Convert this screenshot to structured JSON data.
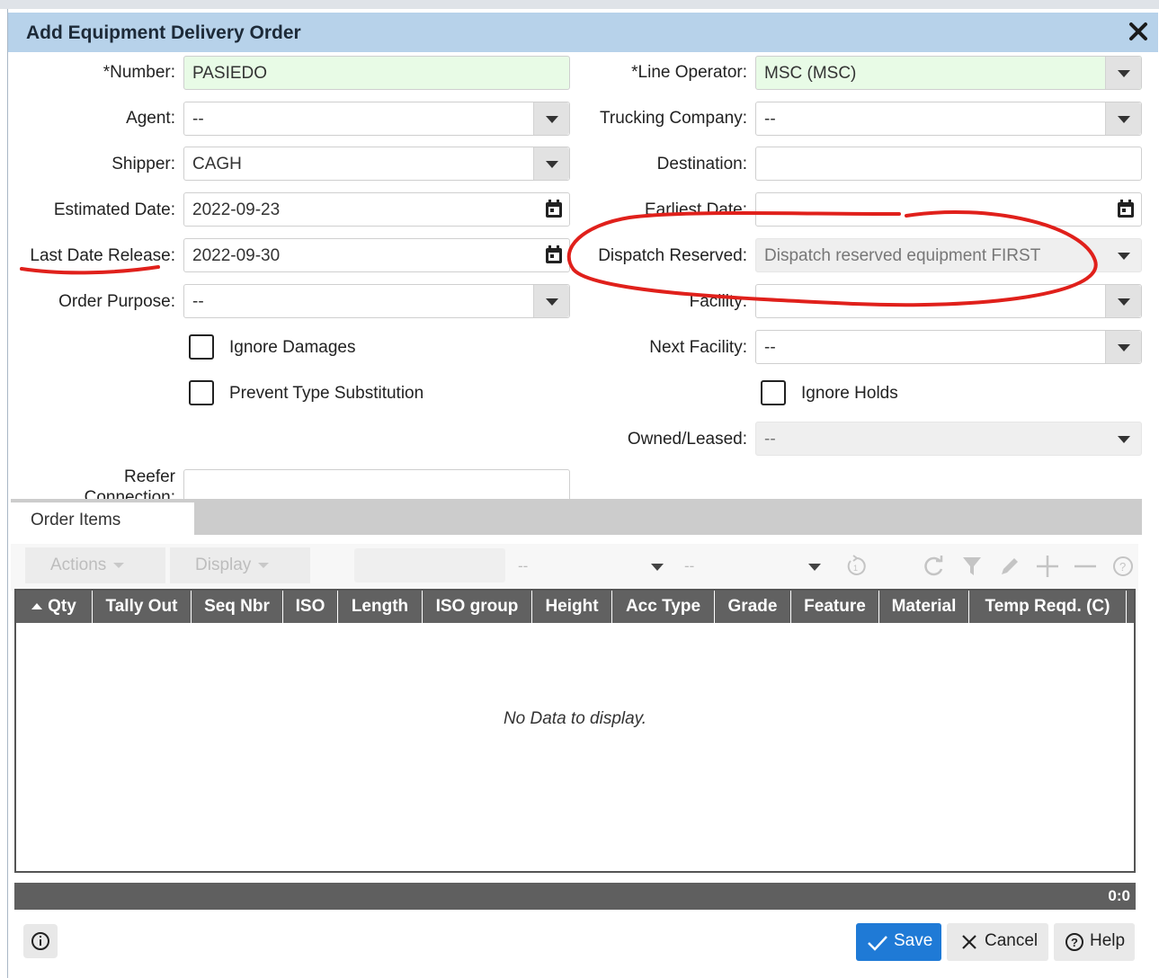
{
  "dialog": {
    "title": "Add Equipment Delivery Order"
  },
  "left_fields": {
    "number": {
      "label": "*Number:",
      "value": "PASIEDO"
    },
    "agent": {
      "label": "Agent:",
      "value": "--"
    },
    "shipper": {
      "label": "Shipper:",
      "value": "CAGH"
    },
    "estimated_date": {
      "label": "Estimated Date:",
      "value": "2022-09-23"
    },
    "last_date_release": {
      "label": "Last Date Release:",
      "value": "2022-09-30"
    },
    "order_purpose": {
      "label": "Order Purpose:",
      "value": "--"
    },
    "ignore_damages": {
      "label": "Ignore Damages",
      "checked": false
    },
    "prevent_type_substitution": {
      "label": "Prevent Type Substitution",
      "checked": false
    },
    "reefer_connection": {
      "label_line1": "Reefer",
      "label_line2": "Connection:",
      "value": ""
    }
  },
  "right_fields": {
    "line_operator": {
      "label": "*Line Operator:",
      "value": "MSC (MSC)"
    },
    "trucking_company": {
      "label": "Trucking Company:",
      "value": "--"
    },
    "destination": {
      "label": "Destination:",
      "value": ""
    },
    "earliest_date": {
      "label": "Earliest Date:",
      "value": ""
    },
    "dispatch_reserved": {
      "label": "Dispatch Reserved:",
      "value": "Dispatch reserved equipment FIRST"
    },
    "facility": {
      "label": "Facility:",
      "value": ""
    },
    "next_facility": {
      "label": "Next Facility:",
      "value": "--"
    },
    "ignore_holds": {
      "label": "Ignore Holds",
      "checked": false
    },
    "owned_leased": {
      "label": "Owned/Leased:",
      "value": "--"
    }
  },
  "tabs": [
    {
      "label": "Order Items",
      "active": true
    }
  ],
  "toolbar": {
    "actions_label": "Actions",
    "display_label": "Display",
    "select1_value": "--",
    "select2_value": "--"
  },
  "grid": {
    "columns": [
      "Qty",
      "Tally Out",
      "Seq Nbr",
      "ISO",
      "Length",
      "ISO group",
      "Height",
      "Acc Type",
      "Grade",
      "Feature",
      "Material",
      "Temp Reqd. (C)"
    ],
    "sorted_column": "Qty",
    "empty_text": "No Data to display.",
    "count": "0:0"
  },
  "buttons": {
    "save": "Save",
    "cancel": "Cancel",
    "help": "Help"
  },
  "colors": {
    "title_bar": "#b7d2ea",
    "primary": "#1f7ad6",
    "required_field": "#e8fbe6",
    "annotation": "#e0201b"
  }
}
